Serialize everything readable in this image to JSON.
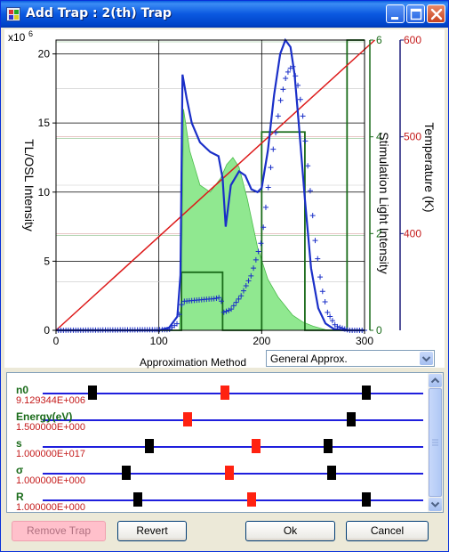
{
  "window": {
    "title": "Add Trap : 2(th) Trap",
    "controls": [
      "minimize-icon",
      "maximize-icon",
      "close-icon"
    ]
  },
  "chart_data": {
    "type": "line",
    "y_multiplier_label": "x10",
    "y_multiplier_exp": "6",
    "left_axis": {
      "label": "TL/OSL Intensity",
      "ticks": [
        "0",
        "5",
        "10",
        "15",
        "20"
      ],
      "range": [
        0,
        21
      ]
    },
    "bottom_axis": {
      "ticks": [
        "0",
        "100",
        "200",
        "300"
      ],
      "range": [
        0,
        300
      ]
    },
    "right_axis_1": {
      "label": "Stimulation Light Intensity",
      "ticks": [
        "0",
        "2",
        "4",
        "6"
      ],
      "range": [
        0,
        6
      ],
      "color": "#1a6b1a"
    },
    "right_axis_2": {
      "label": "Temperature (K)",
      "ticks": [
        "400",
        "500",
        "600"
      ],
      "range": [
        300,
        600
      ],
      "color": "#c41a1a"
    },
    "grid": true,
    "series": [],
    "colors": {
      "total": "#1a2fc8",
      "fit": "#1a2fc8",
      "area": "#90e890",
      "temperature": "#dd1a1a",
      "stimulation": "#1a6b1a"
    },
    "total_curve": {
      "x": [
        0,
        100,
        110,
        118,
        121,
        123,
        127,
        132,
        140,
        150,
        158,
        162,
        165,
        170,
        178,
        184,
        190,
        196,
        200,
        206,
        212,
        218,
        223,
        228,
        232,
        236,
        242,
        248,
        255,
        262,
        270,
        280,
        295,
        300
      ],
      "y": [
        0.0,
        0.0,
        0.2,
        1.0,
        4.0,
        18.5,
        16.8,
        15.0,
        13.6,
        12.9,
        12.6,
        11.0,
        7.5,
        10.5,
        11.5,
        11.2,
        10.2,
        10.0,
        10.3,
        13.0,
        17.0,
        20.0,
        21.0,
        20.5,
        18.5,
        15.0,
        9.5,
        4.5,
        1.6,
        0.5,
        0.1,
        0.0,
        0.0,
        0.0
      ]
    },
    "fit_curve": {
      "x": [
        0,
        110,
        118,
        122,
        124,
        140,
        155,
        160,
        163,
        170,
        180,
        190,
        200,
        210,
        218,
        224,
        230,
        236,
        240,
        246,
        252,
        258,
        264,
        272,
        285,
        300
      ],
      "y": [
        0.0,
        0.05,
        0.5,
        1.8,
        2.1,
        2.2,
        2.3,
        2.4,
        1.3,
        1.5,
        2.5,
        4.0,
        6.5,
        12.5,
        16.5,
        18.5,
        19.2,
        17.5,
        15.5,
        11.0,
        6.5,
        3.2,
        1.3,
        0.3,
        0.0,
        0.0
      ]
    },
    "component_area": {
      "x": [
        120,
        122,
        124,
        130,
        140,
        150,
        160,
        166,
        172,
        178,
        186,
        196,
        206,
        216,
        230,
        240,
        250,
        262,
        270
      ],
      "y": [
        0.0,
        3.0,
        16.0,
        13.0,
        10.5,
        10.0,
        11.0,
        12.0,
        12.5,
        11.8,
        9.5,
        6.0,
        3.7,
        2.4,
        1.1,
        0.6,
        0.3,
        0.05,
        0.0
      ]
    },
    "temperature_line": {
      "x": [
        0,
        310
      ],
      "y_temp": [
        300,
        600
      ]
    },
    "stimulation_steps": {
      "x": [
        0,
        122,
        122,
        162,
        162,
        200,
        200,
        242,
        242,
        283,
        283,
        300
      ],
      "y": [
        0,
        0,
        1.2,
        1.2,
        0,
        0,
        4.1,
        4.1,
        0,
        0,
        6.0,
        6.0
      ]
    }
  },
  "approximation": {
    "label": "Approximation Method",
    "selected": "General Approx."
  },
  "parameters": [
    {
      "name": "n0",
      "value": "9.129344E+006",
      "markers": [
        {
          "color": "black",
          "pos": 0.13
        },
        {
          "color": "red",
          "pos": 0.48
        },
        {
          "color": "black",
          "pos": 0.85
        }
      ]
    },
    {
      "name": "Energy(eV)",
      "value": "1.500000E+000",
      "markers": [
        {
          "color": "red",
          "pos": 0.38
        },
        {
          "color": "black",
          "pos": 0.81
        }
      ]
    },
    {
      "name": "s",
      "value": "1.000000E+017",
      "markers": [
        {
          "color": "black",
          "pos": 0.28
        },
        {
          "color": "red",
          "pos": 0.56
        },
        {
          "color": "black",
          "pos": 0.75
        }
      ]
    },
    {
      "name": "σ",
      "value": "1.000000E+000",
      "markers": [
        {
          "color": "black",
          "pos": 0.22
        },
        {
          "color": "red",
          "pos": 0.49
        },
        {
          "color": "black",
          "pos": 0.76
        }
      ]
    },
    {
      "name": "R",
      "value": "1.000000E+000",
      "markers": [
        {
          "color": "black",
          "pos": 0.25
        },
        {
          "color": "red",
          "pos": 0.55
        },
        {
          "color": "black",
          "pos": 0.85
        }
      ]
    }
  ],
  "buttons": {
    "remove": "Remove Trap",
    "revert": "Revert",
    "ok": "Ok",
    "cancel": "Cancel"
  }
}
